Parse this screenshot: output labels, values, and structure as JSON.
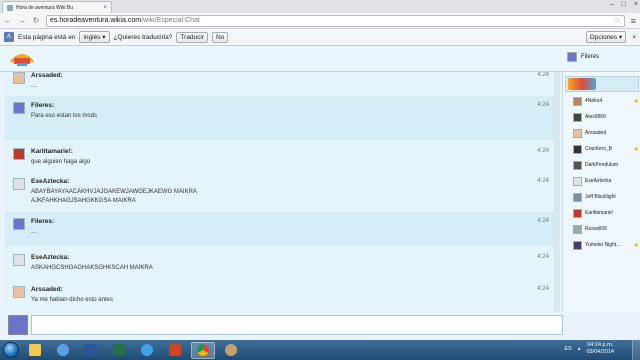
{
  "browser": {
    "tab_title": "Hora de aventura Wiki Bu",
    "address_domain": "es.horadeaventura.wikia.com",
    "address_path": "/wiki/Especial:Chat"
  },
  "translate_bar": {
    "prefix": "Esta página está en",
    "language": "inglés",
    "question": "¿Quieres traducirla?",
    "translate_button": "Traducir",
    "no_button": "No",
    "options_button": "Opciones"
  },
  "header": {
    "current_user": "Fileres"
  },
  "messages": [
    {
      "user": "Arssaded:",
      "text": [
        "..."
      ],
      "time": "4:24",
      "avatar_color": "#e8c1a0",
      "alt": false
    },
    {
      "user": "Fileres:",
      "text": [
        "Para eso estan los mods"
      ],
      "time": "4:24",
      "avatar_color": "#6c74c9",
      "alt": true
    },
    {
      "user": "Karlitamarie!:",
      "text": [
        "que alguien haga algo"
      ],
      "time": "4:24",
      "avatar_color": "#c0392b",
      "alt": false
    },
    {
      "user": "EseAztecka:",
      "text": [
        "ABAYBAYAYAACAKHVJAJGAKEWJAWGEJKAEWG MAIKRA",
        "AJKFAHKHAGJSAHGKKGSA MAIKRA"
      ],
      "time": "4:24",
      "avatar_color": "#dfe3e6",
      "alt": false
    },
    {
      "user": "Fileres:",
      "text": [
        "..."
      ],
      "time": "4:24",
      "avatar_color": "#6c74c9",
      "alt": true
    },
    {
      "user": "EseAztecka:",
      "text": [
        "ASKAHGCSHGAGHAKSGHKSCAH MAIKRA"
      ],
      "time": "4:24",
      "avatar_color": "#dfe3e6",
      "alt": false
    },
    {
      "user": "Arssaded:",
      "text": [
        "Ya me habian dicho esto antes"
      ],
      "time": "4:24",
      "avatar_color": "#e8c1a0",
      "alt": false
    }
  ],
  "sidebar": {
    "users": [
      {
        "name": "4Neko4",
        "star": true,
        "color": "#b58863"
      },
      {
        "name": "Alex9960",
        "star": false,
        "color": "#444"
      },
      {
        "name": "Arssaded",
        "star": false,
        "color": "#e8c1a0"
      },
      {
        "name": "CracKers_B",
        "star": true,
        "color": "#333"
      },
      {
        "name": "DarkPendulum",
        "star": false,
        "color": "#555"
      },
      {
        "name": "EseAztecka",
        "star": false,
        "color": "#dfe3e6"
      },
      {
        "name": "Jeff Blacklight",
        "star": false,
        "color": "#7a8fa6"
      },
      {
        "name": "Karlitamarie!",
        "star": false,
        "color": "#c0392b"
      },
      {
        "name": "Russell06",
        "star": false,
        "color": "#9aa"
      },
      {
        "name": "Yumeko Night...",
        "star": true,
        "color": "#4a3b6b"
      }
    ]
  },
  "taskbar": {
    "lang": "ES",
    "time": "04:24 p.m.",
    "date": "03/04/2014"
  }
}
